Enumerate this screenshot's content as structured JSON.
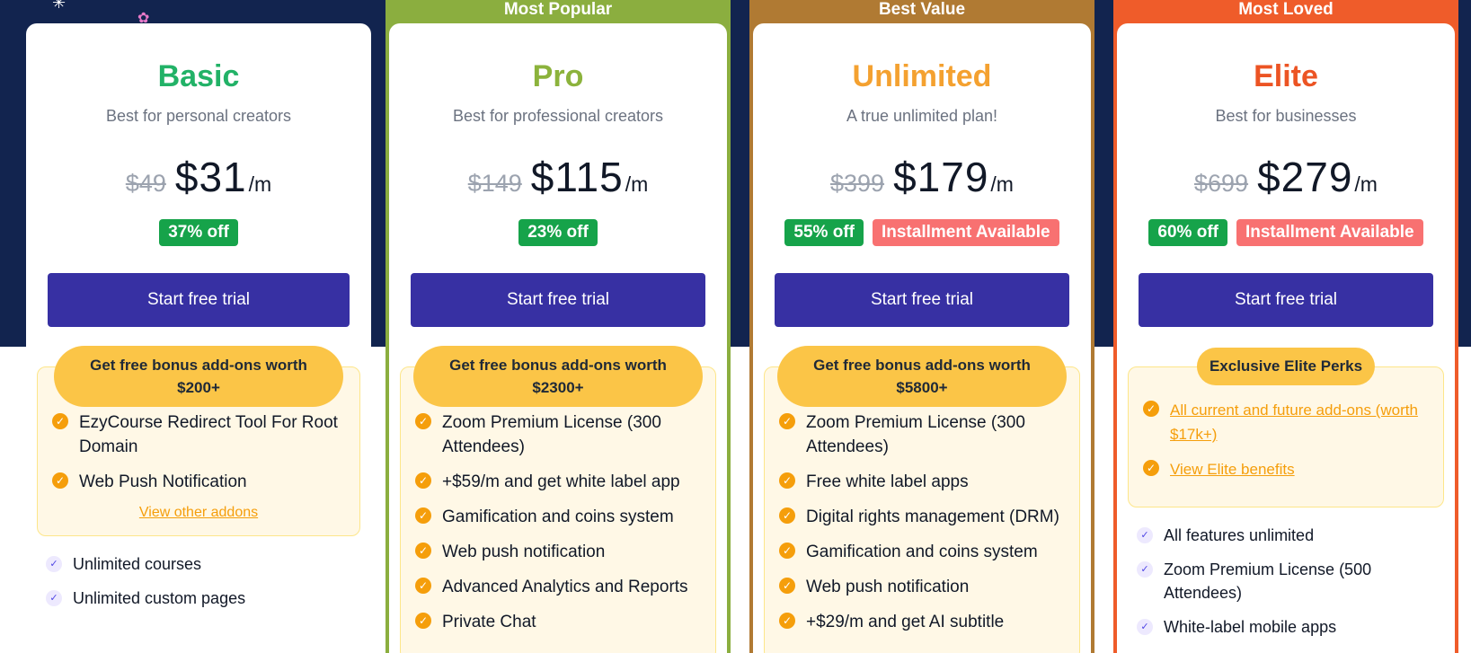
{
  "colors": {
    "hero_bg": "#12244f",
    "cta_bg": "#3730a3",
    "basic_name": "#22b267",
    "pro_name": "#8cb33c",
    "unlimited_name": "#f4a130",
    "elite_name": "#ec5424",
    "pro_ribbon": "#8bae3f",
    "unlimited_ribbon": "#b07a33",
    "elite_ribbon": "#ef5c2a",
    "discount_badge": "#16a34a",
    "installment_badge": "#f87171",
    "bonus_pill": "#fbc547"
  },
  "plans": {
    "basic": {
      "name": "Basic",
      "tagline": "Best for personal creators",
      "old_price": "$49",
      "price": "$31",
      "unit": "/m",
      "discount": "37% off",
      "cta": "Start free trial",
      "bonus_title": "Get free bonus add-ons worth $200+",
      "bonus_items": [
        "EzyCourse Redirect Tool For Root Domain",
        "Web Push Notification"
      ],
      "addons_link": "View other addons",
      "features": [
        "Unlimited courses",
        "Unlimited custom pages"
      ]
    },
    "pro": {
      "ribbon": "Most Popular",
      "name": "Pro",
      "tagline": "Best for professional creators",
      "old_price": "$149",
      "price": "$115",
      "unit": "/m",
      "discount": "23% off",
      "cta": "Start free trial",
      "bonus_title": "Get free bonus add-ons worth $2300+",
      "bonus_items": [
        "Zoom Premium License (300 Attendees)",
        "+$59/m and get white label app",
        "Gamification and coins system",
        "Web push notification",
        "Advanced Analytics and Reports",
        "Private Chat"
      ]
    },
    "unlimited": {
      "ribbon": "Best Value",
      "name": "Unlimited",
      "tagline": "A true unlimited plan!",
      "old_price": "$399",
      "price": "$179",
      "unit": "/m",
      "discount": "55% off",
      "installment": "Installment Available",
      "cta": "Start free trial",
      "bonus_title": "Get free bonus add-ons worth $5800+",
      "bonus_items": [
        "Zoom Premium License (300 Attendees)",
        "Free white label apps",
        "Digital rights management (DRM)",
        "Gamification and coins system",
        "Web push notification",
        "+$29/m and get AI subtitle"
      ]
    },
    "elite": {
      "ribbon": "Most Loved",
      "name": "Elite",
      "tagline": "Best for businesses",
      "old_price": "$699",
      "price": "$279",
      "unit": "/m",
      "discount": "60% off",
      "installment": "Installment Available",
      "cta": "Start free trial",
      "perks_title": "Exclusive Elite Perks",
      "perk_links": [
        "All current and future add-ons (worth $17k+)",
        "View Elite benefits"
      ],
      "features": [
        "All features unlimited",
        "Zoom Premium License (500 Attendees)",
        "White-label mobile apps"
      ]
    }
  }
}
